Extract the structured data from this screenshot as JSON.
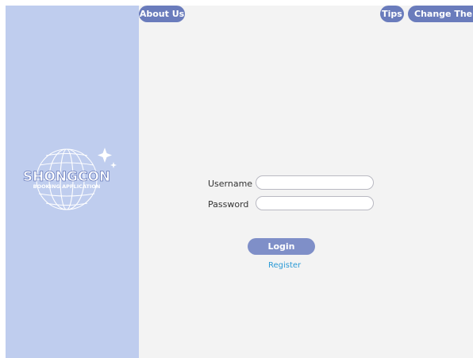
{
  "header": {
    "about_label": "About Us",
    "tips_label": "Tips",
    "theme_label": "Change Theme"
  },
  "logo": {
    "title": "SHONGCON",
    "subtitle": "BOOKING APPLICATION"
  },
  "form": {
    "username_label": "Username",
    "username_value": "",
    "password_label": "Password",
    "password_value": "",
    "login_label": "Login",
    "register_label": "Register"
  },
  "colors": {
    "sidebar": "#bfcdee",
    "button": "#6a7cbc",
    "login_button": "#7f8fc8",
    "link": "#2a9ad6",
    "background": "#f3f3f3"
  }
}
